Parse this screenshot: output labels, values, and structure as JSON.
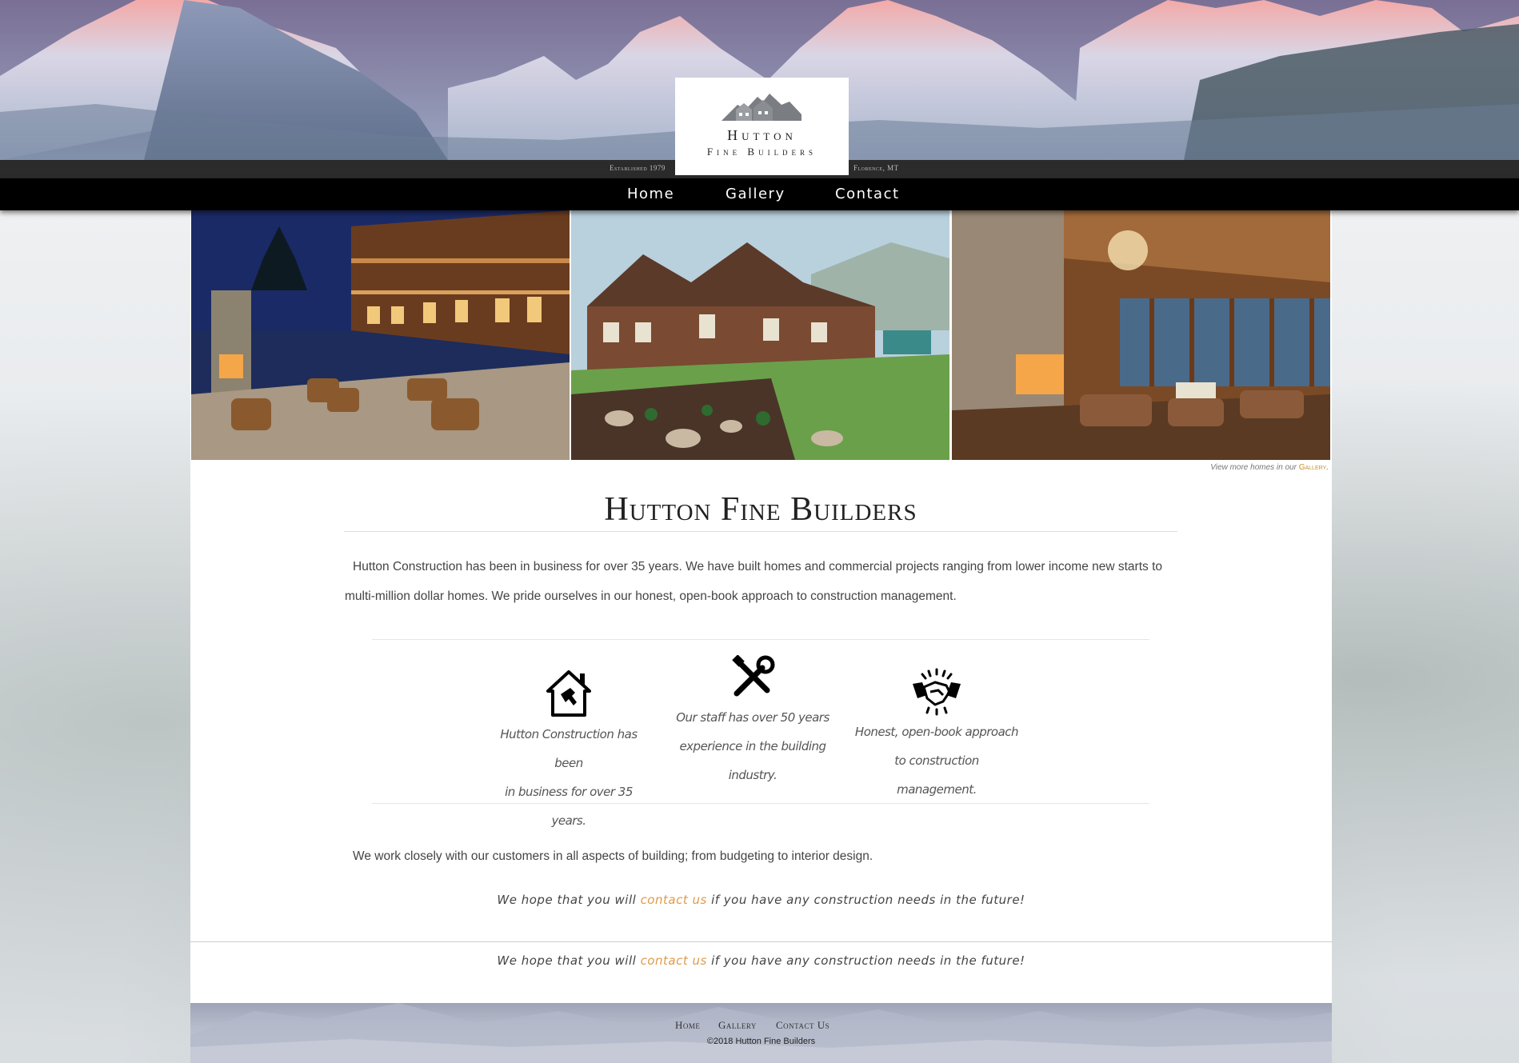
{
  "brand": {
    "name_line1": "Hutton",
    "name_line2": "Fine Builders",
    "established": "Established 1979",
    "location": "Florence, MT"
  },
  "nav": {
    "items": [
      "Home",
      "Gallery",
      "Contact"
    ]
  },
  "gallery_caption": {
    "prefix": "View more homes in our ",
    "link": "Gallery",
    "suffix": "."
  },
  "main": {
    "title": "Hutton Fine Builders",
    "intro": "Hutton Construction has been in business for over 35 years. We have built homes and commercial projects ranging from lower income new starts to multi-million dollar homes. We pride ourselves in our honest, open-book approach to construction management.",
    "features": [
      {
        "icon": "house-hammer-icon",
        "text_line1": "Hutton Construction has been",
        "text_line2": "in business for over 35 years.",
        "text_line3": ""
      },
      {
        "icon": "wrench-screwdriver-icon",
        "text_line1": "Our staff has over 50 years",
        "text_line2": "experience in the building",
        "text_line3": "industry."
      },
      {
        "icon": "handshake-icon",
        "text_line1": "Honest, open-book approach",
        "text_line2": "to construction management.",
        "text_line3": ""
      }
    ],
    "closing": "We work closely with our customers in all aspects of building; from budgeting to interior design.",
    "hope_prefix": "We hope that you will ",
    "hope_link": "contact us",
    "hope_suffix": " if you have any construction needs in the future!"
  },
  "footer": {
    "links": [
      "Home",
      "Gallery",
      "Contact Us"
    ],
    "copyright": "©2018 Hutton Fine Builders"
  },
  "colors": {
    "accent": "#e09a4a",
    "nav_bg": "#000000",
    "info_bar": "#2b2b2b"
  }
}
